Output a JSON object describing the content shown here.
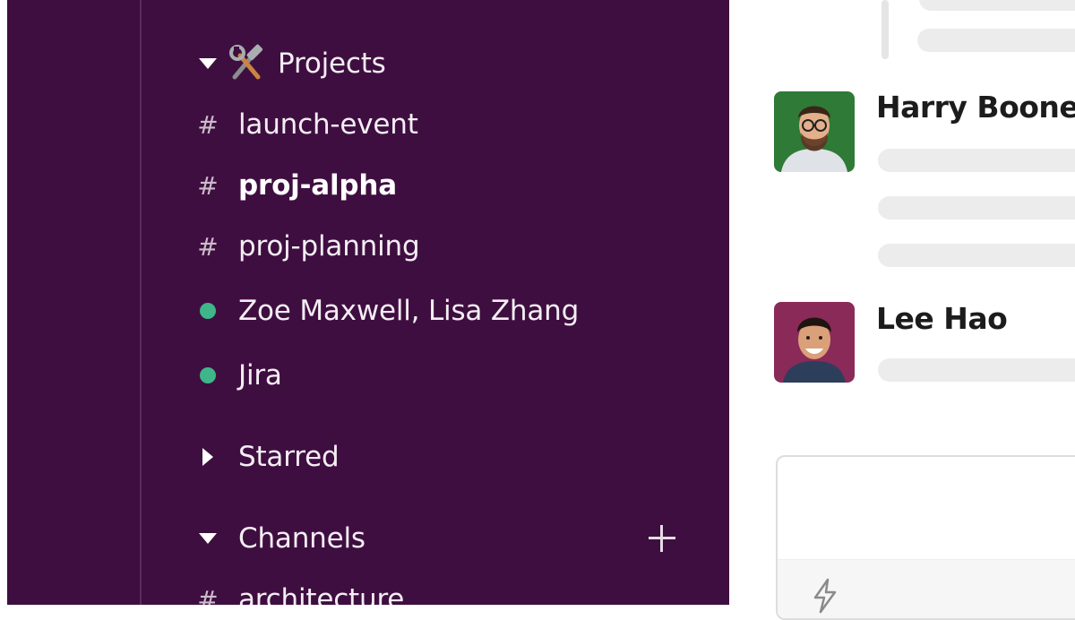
{
  "sidebar": {
    "sections": {
      "projects": {
        "label": "Projects",
        "emoji_icon": "hammer-and-wrench-icon"
      },
      "starred": {
        "label": "Starred"
      },
      "channels": {
        "label": "Channels",
        "add_icon": "plus-icon"
      }
    },
    "project_items": [
      {
        "type": "channel",
        "label": "launch-event",
        "bold": false
      },
      {
        "type": "channel",
        "label": "proj-alpha",
        "bold": true
      },
      {
        "type": "channel",
        "label": "proj-planning",
        "bold": false
      },
      {
        "type": "dm",
        "label": "Zoe Maxwell, Lisa Zhang",
        "presence": "online"
      },
      {
        "type": "dm",
        "label": "Jira",
        "presence": "online"
      }
    ],
    "channel_items": [
      {
        "type": "channel",
        "label": "architecture"
      }
    ]
  },
  "messages": [
    {
      "sender": "Harry Boone",
      "avatar_bg": "#2f7a36"
    },
    {
      "sender": "Lee Hao",
      "avatar_bg": "#8a2a58"
    }
  ],
  "composer": {
    "shortcut_icon": "lightning-bolt-icon"
  },
  "colors": {
    "sidebar_bg": "#3f0e40",
    "presence_online": "#3fb58a",
    "placeholder_bar": "#ececec"
  }
}
